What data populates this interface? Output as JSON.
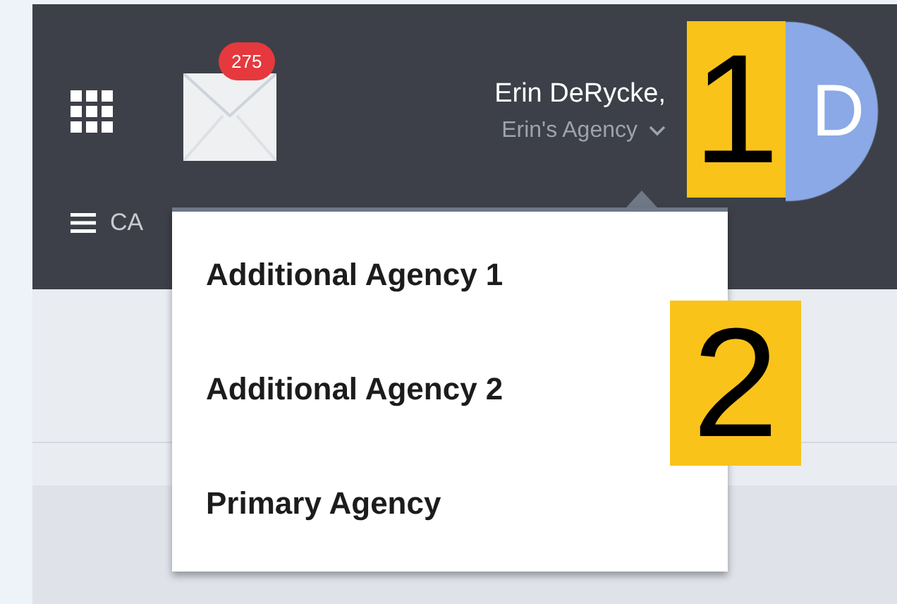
{
  "header": {
    "mail_count": "275",
    "user_name": "Erin DeRycke,",
    "agency": "Erin's Agency",
    "avatar_initial": "D"
  },
  "nav": {
    "items": [
      {
        "label": "CA"
      }
    ]
  },
  "agency_menu": {
    "items": [
      {
        "label": "Additional Agency 1",
        "selected": false
      },
      {
        "label": "Additional Agency 2",
        "selected": false
      },
      {
        "label": "Primary Agency",
        "selected": false
      }
    ]
  },
  "callouts": [
    {
      "label": "1"
    },
    {
      "label": "2"
    }
  ]
}
